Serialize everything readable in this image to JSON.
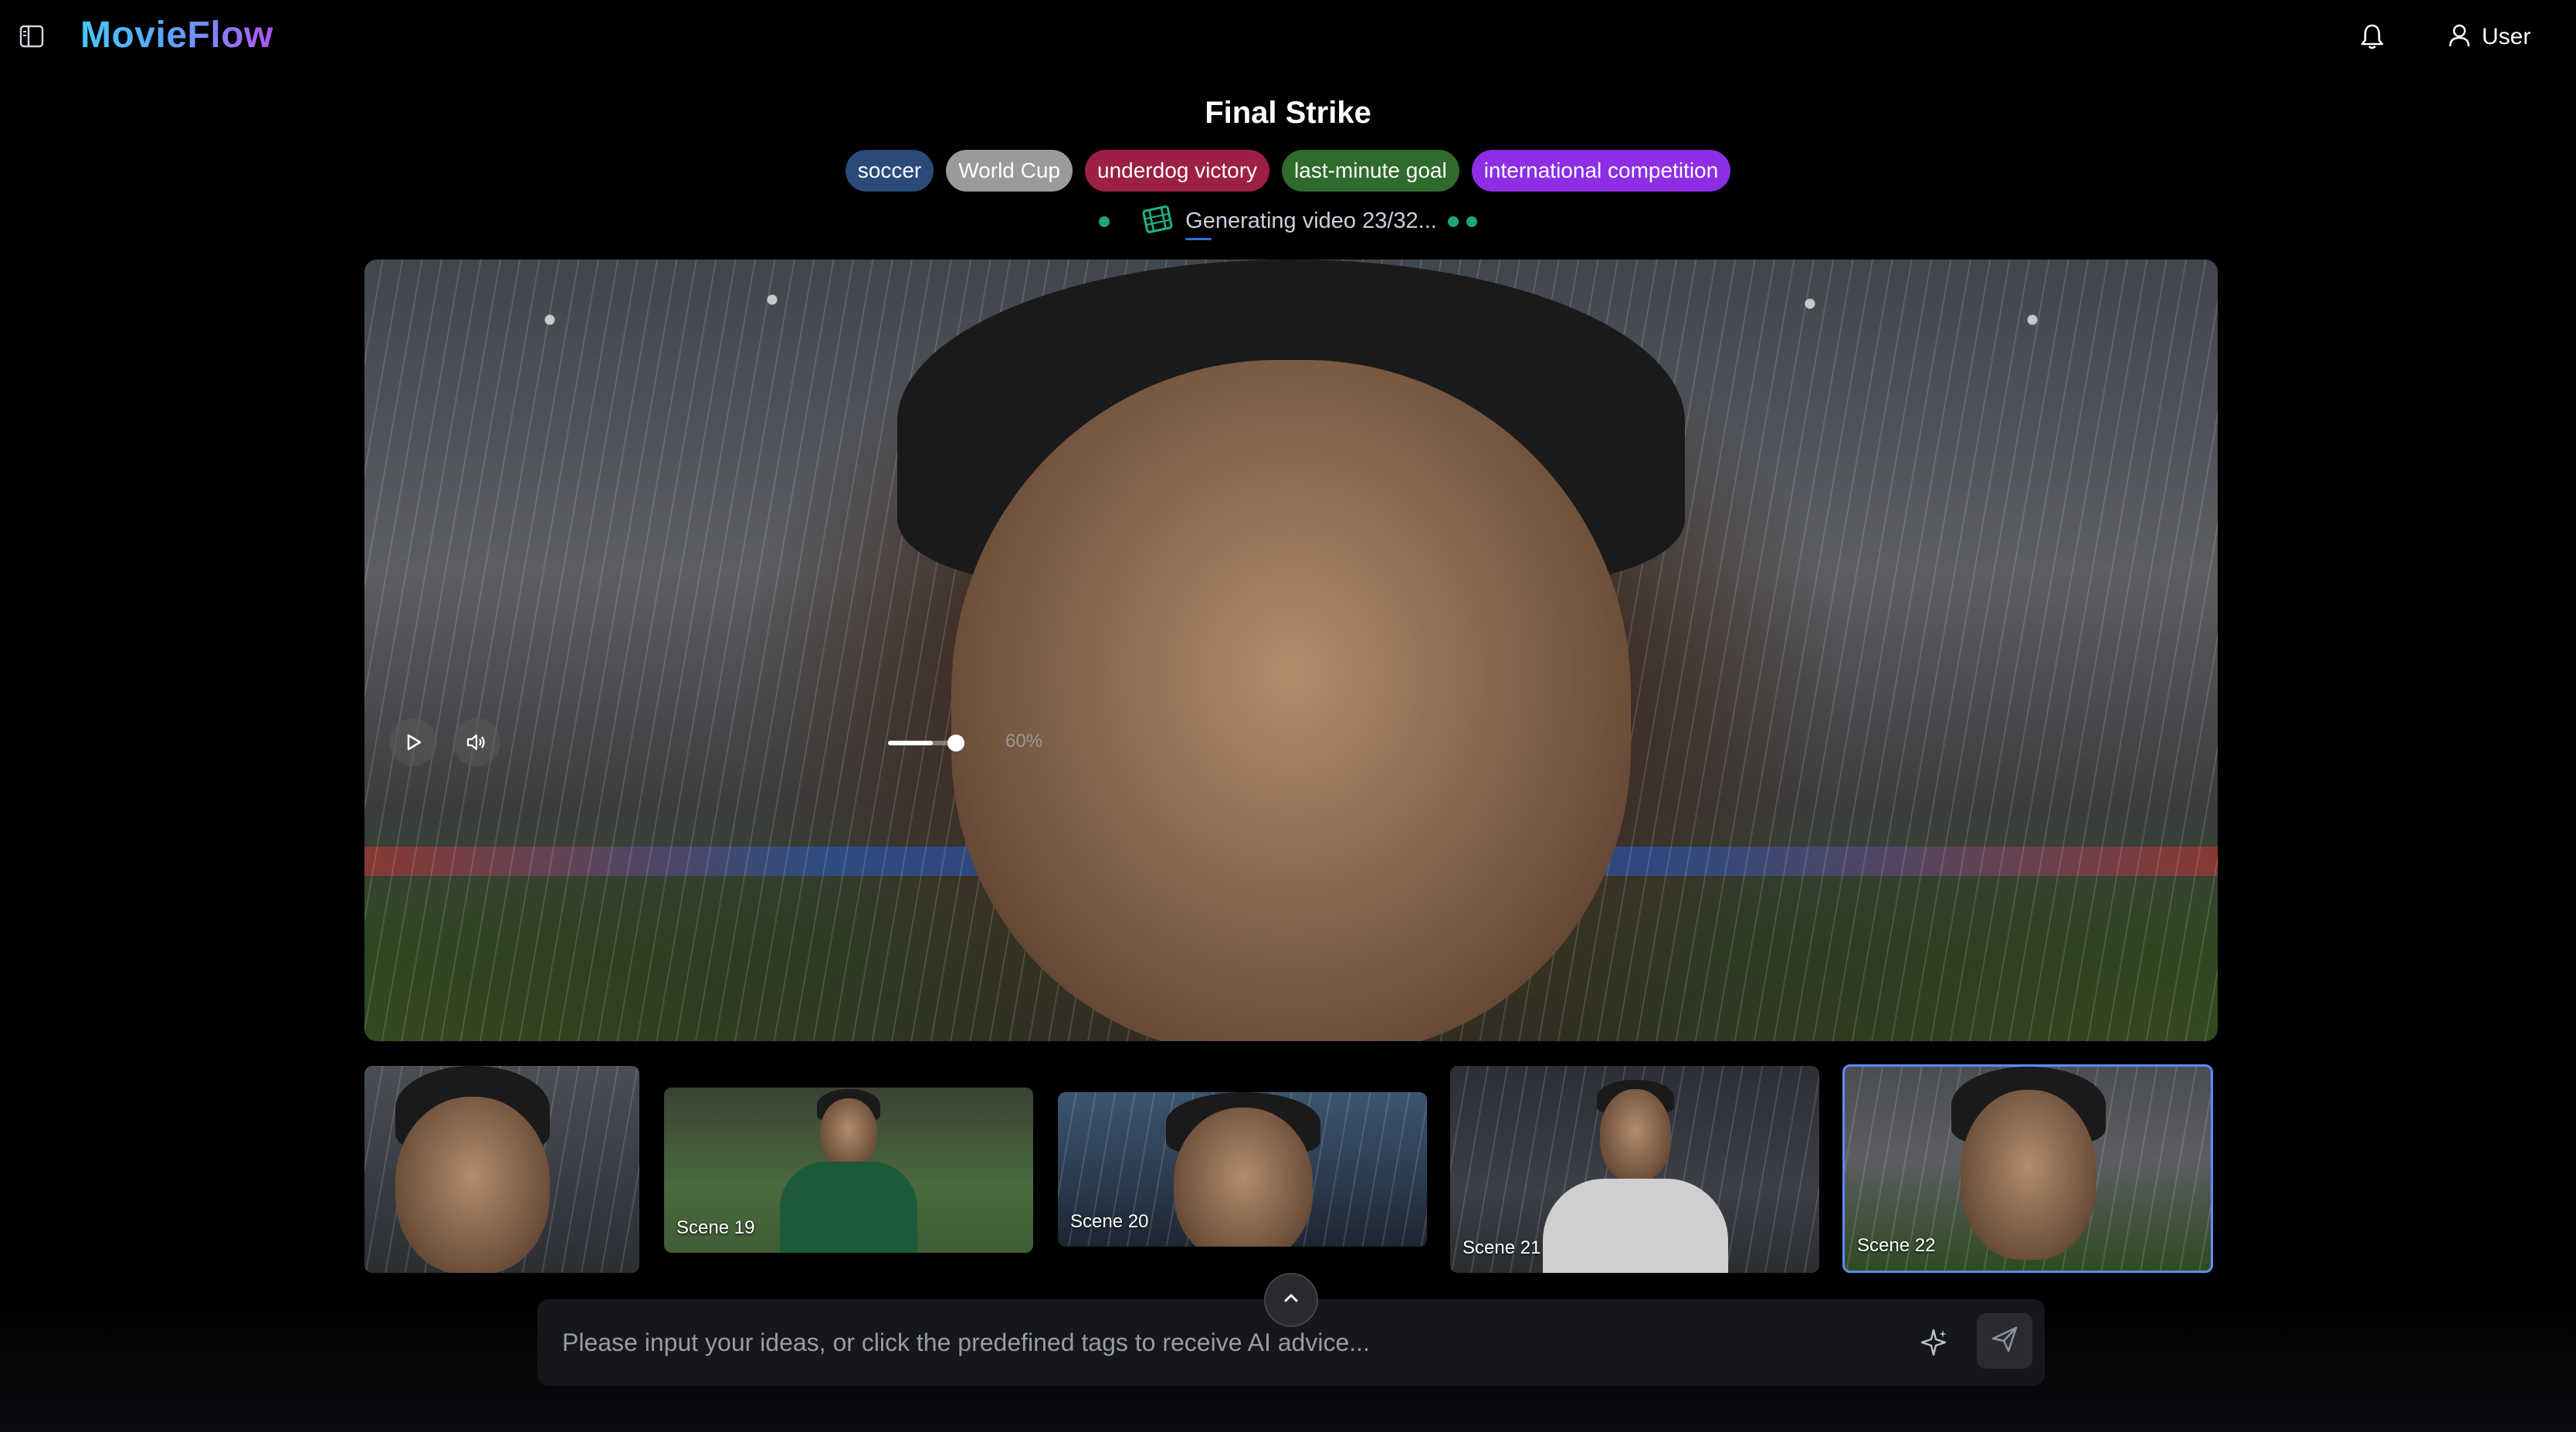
{
  "header": {
    "brand": "MovieFlow",
    "user_label": "User"
  },
  "project": {
    "title": "Final Strike",
    "tags": [
      {
        "label": "soccer",
        "color": "#2b4a7a"
      },
      {
        "label": "World Cup",
        "color": "#9a9a9a"
      },
      {
        "label": "underdog victory",
        "color": "#9c1f45"
      },
      {
        "label": "last-minute goal",
        "color": "#2f6b2c"
      },
      {
        "label": "international competition",
        "color": "#8d2ee6"
      }
    ],
    "status": "Generating video 23/32..."
  },
  "player": {
    "volume_label": "60%",
    "volume_level": 0.6
  },
  "scenes": [
    {
      "label": ""
    },
    {
      "label": "Scene 19"
    },
    {
      "label": "Scene 20"
    },
    {
      "label": "Scene 21"
    },
    {
      "label": "Scene 22",
      "selected": true
    }
  ],
  "chat": {
    "placeholder": "Please input your ideas, or click the predefined tags to receive AI advice..."
  },
  "colors": {
    "accent": "#5b8cff",
    "status_dot": "#1fa37a",
    "selected_border": "#5b8cff"
  },
  "icons": [
    "sidebar-toggle-icon",
    "bell-icon",
    "user-icon",
    "film-icon",
    "play-icon",
    "volume-icon",
    "chevron-up-icon",
    "sparkle-icon",
    "send-icon"
  ]
}
